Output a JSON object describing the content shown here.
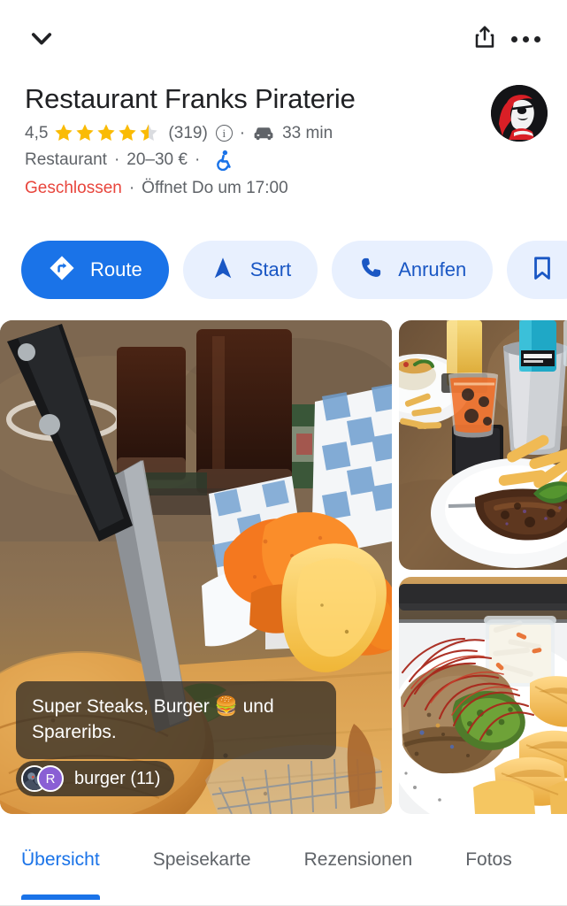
{
  "topbar": {
    "collapse_icon": "chevron-down-icon",
    "share_icon": "share-icon",
    "more_icon": "more-options-icon"
  },
  "place": {
    "name": "Restaurant Franks Piraterie",
    "rating_value": "4,5",
    "rating_stars": 4.5,
    "review_count": "(319)",
    "info_glyph": "i",
    "separator": "·",
    "drive_icon": "car-icon",
    "drive_time": "33 min",
    "category": "Restaurant",
    "price_range": "20–30 €",
    "accessibility_icon": "wheelchair-accessible-icon",
    "status": "Geschlossen",
    "opens_text": "Öffnet Do um 17:00",
    "avatar": "pirate-logo-avatar"
  },
  "actions": [
    {
      "label": "Route",
      "icon": "directions-icon",
      "style": "primary"
    },
    {
      "label": "Start",
      "icon": "navigation-arrow-icon",
      "style": "secondary"
    },
    {
      "label": "Anrufen",
      "icon": "phone-icon",
      "style": "secondary"
    },
    {
      "label": "",
      "icon": "bookmark-icon",
      "style": "secondary"
    }
  ],
  "photos": {
    "main": {
      "alt": "burger-with-knife-and-fries-photo",
      "caption": "Super Steaks, Burger 🍔 und Spareribs.",
      "credit_tag": "burger (11)",
      "credit_avatar_initial": "R"
    },
    "top_right": {
      "alt": "table-with-drinks-and-ribs-photo"
    },
    "bottom_right": {
      "alt": "steak-with-chips-and-coleslaw-photo"
    }
  },
  "tabs": [
    {
      "label": "Übersicht",
      "active": true
    },
    {
      "label": "Speisekarte",
      "active": false
    },
    {
      "label": "Rezensionen",
      "active": false
    },
    {
      "label": "Fotos",
      "active": false
    }
  ],
  "colors": {
    "accent": "#1a73e8",
    "accent_soft": "#e8f0fe",
    "closed_red": "#e8453c",
    "star_gold": "#fabb05",
    "text_primary": "#202124",
    "text_secondary": "#5f6368"
  }
}
